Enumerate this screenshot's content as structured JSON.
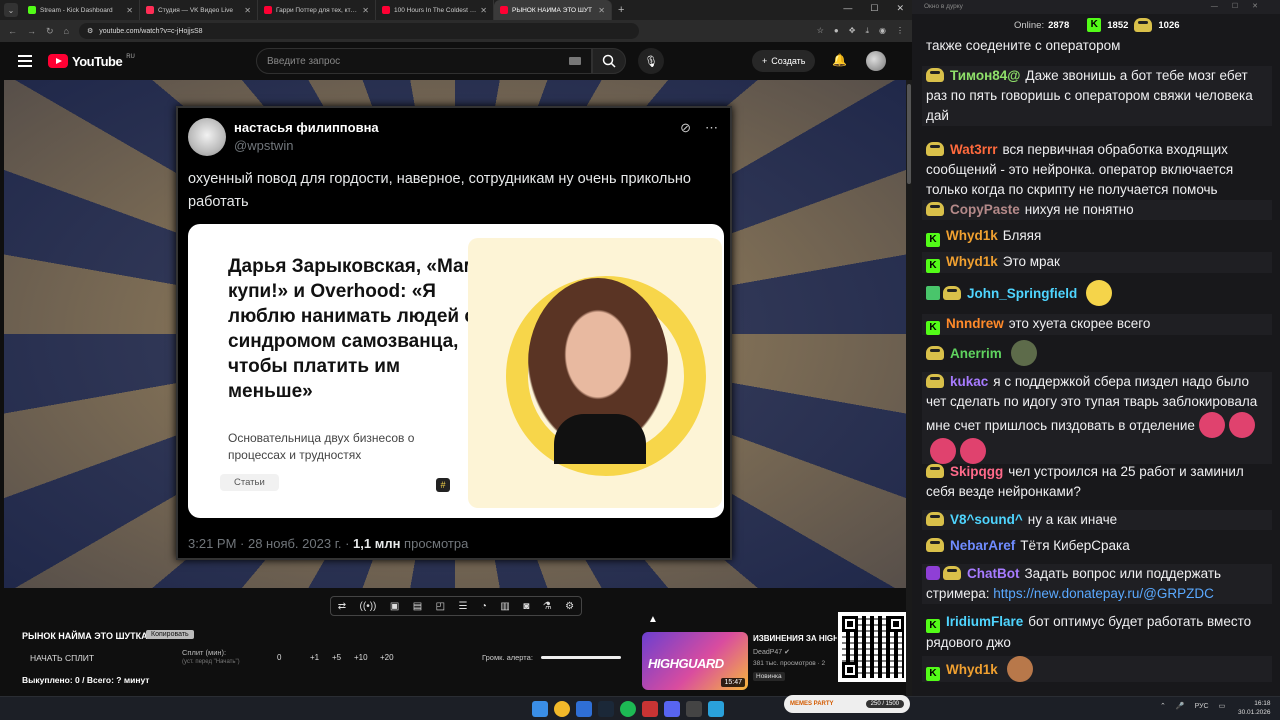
{
  "browser": {
    "tabs": [
      {
        "title": "Stream - Kick Dashboard",
        "color": "#53fc18"
      },
      {
        "title": "Студия — VK Видео Live",
        "color": "#ff2d55"
      },
      {
        "title": "Гарри Поттер для тех, кто вы",
        "color": "#ff0033"
      },
      {
        "title": "100 Hours In The Coldest City",
        "color": "#ff0033"
      },
      {
        "title": "РЫНОК НАЙМА ЭТО ШУТ",
        "color": "#ff0033"
      }
    ],
    "url": "youtube.com/watch?v=c-jHojjsS8"
  },
  "youtube": {
    "logo": "YouTube",
    "region": "RU",
    "search_placeholder": "Введите запрос",
    "create_label": "Создать"
  },
  "tweet": {
    "name": "настасья филипповна",
    "handle": "@wpstwin",
    "text": "охуенный повод для гордости, наверное, сотрудникам ну очень прикольно работать",
    "card_title": "Дарья Зарыковская, «Мам, купи!» и Overhood: «Я люблю нанимать людей с синдромом самозванца, чтобы платить им меньше»",
    "card_subtitle": "Основательница двух бизнесов о процессах и трудностях",
    "card_tag": "Статьи",
    "meta_time": "3:21 PM · 28 нояб. 2023 г. · ",
    "meta_views": "1,1 млн",
    "meta_views_label": " просмотра"
  },
  "dashboard": {
    "title": "РЫНОК НАЙМА ЭТО ШУТКА",
    "badge": "Копировать",
    "split_button": "НАЧАТЬ СПЛИТ",
    "split_label": "Сплит (мин):",
    "split_hint": "(уст. перед \"Начать\")",
    "split_value": "0",
    "steps": [
      "+1",
      "+5",
      "+10",
      "+20"
    ],
    "bought": "Выкуплено: 0 / Всего: ? минут",
    "volume_label": "Громк. алерта:"
  },
  "recommendation": {
    "thumb_text": "HIGHGUARD",
    "duration": "15:47",
    "title": "ИЗВИНЕНИЯ ЗА HIGHGUARD",
    "channel": "DeadP47 ✔",
    "views": "381 тыс. просмотров · 2",
    "badge": "Новинка"
  },
  "chat": {
    "window_title": "Окно в дурку",
    "online_label": "Online:",
    "online": "2878",
    "kick_count": "1852",
    "other_count": "1026",
    "messages": [
      {
        "nick": "",
        "color": "#ffffff",
        "text": "также соедените с оператором",
        "badges": []
      },
      {
        "nick": "Тимон84@",
        "color": "#8fe06a",
        "text": "Даже звонишь а бот тебе мозг ебет раз по пять говоришь с оператором свяжи человека дай",
        "badges": [
          "pepe"
        ]
      },
      {
        "nick": "Wat3rrr",
        "color": "#ff6a3d",
        "text": "вся первичная обработка входящих сообщений - это нейронка. оператор включается только когда по скрипту не получается помочь",
        "badges": [
          "pepe"
        ]
      },
      {
        "nick": "CopyPaste",
        "color": "#b58a8a",
        "text": "нихуя не понятно",
        "badges": [
          "pepe"
        ]
      },
      {
        "nick": "Whyd1k",
        "color": "#f0a030",
        "text": "Бляяя",
        "badges": [
          "kick"
        ]
      },
      {
        "nick": "Whyd1k",
        "color": "#f0a030",
        "text": "Это мрак",
        "badges": [
          "kick"
        ]
      },
      {
        "nick": "John_Springfield",
        "color": "#4fd5ff",
        "text": "",
        "badges": [
          "pencil",
          "pepe"
        ],
        "emotes": [
          "#f5d44a"
        ]
      },
      {
        "nick": "Nnndrew",
        "color": "#ff8a2a",
        "text": "это хуета скорее всего",
        "badges": [
          "kick"
        ]
      },
      {
        "nick": "Anerrim",
        "color": "#5fd35f",
        "text": "",
        "badges": [
          "pepe"
        ],
        "emotes": [
          "#5d6b4a"
        ]
      },
      {
        "nick": "kukac",
        "color": "#a77bff",
        "text": "я с поддержкой сбера пиздел надо было чет сделать по идогу это тупая  тварь заблокировала мне счет пришлось пиздовать в отделение",
        "badges": [
          "pepe"
        ],
        "emotes": [
          "#e0426e",
          "#e0426e",
          "#e0426e",
          "#e0426e"
        ]
      },
      {
        "nick": "Skipqgg",
        "color": "#ff6a8a",
        "text": "чел устроился на 25 работ и заминил себя везде нейронками?",
        "badges": [
          "pepe"
        ]
      },
      {
        "nick": "V8^sound^",
        "color": "#4fd5ff",
        "text": "ну а как иначе",
        "badges": [
          "pepe"
        ]
      },
      {
        "nick": "NebarAref",
        "color": "#6f8cff",
        "text": "Тётя КиберСрака",
        "badges": [
          "pepe"
        ]
      },
      {
        "nick": "ChatBot",
        "color": "#a77bff",
        "text": "Задать вопрос или поддержать стримера: ",
        "link": "https://new.donatepay.ru/@GRPZDC",
        "badges": [
          "ghost",
          "pepe"
        ]
      },
      {
        "nick": "IridiumFlare",
        "color": "#4fd5ff",
        "text": "бот оптимус будет работать вместо рядового джо",
        "badges": [
          "kick"
        ]
      },
      {
        "nick": "Whyd1k",
        "color": "#f0a030",
        "text": "",
        "badges": [
          "kick"
        ],
        "emotes": [
          "#b8784a"
        ]
      }
    ]
  },
  "taskbar": {
    "memes_label": "MEMES PARTY",
    "memes_counter": "250 / 1500",
    "lang": "РУС",
    "time": "16:18",
    "date": "30.01.2026"
  }
}
